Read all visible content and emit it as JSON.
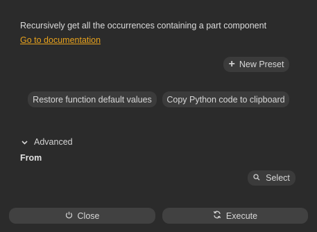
{
  "description": "Recursively get all the occurrences containing a part component",
  "doc_link": "Go to documentation",
  "presets": {
    "new_preset_label": "New Preset"
  },
  "actions": {
    "restore_label": "Restore function default values",
    "copy_label": "Copy Python code to clipboard"
  },
  "advanced": {
    "label": "Advanced"
  },
  "from": {
    "label": "From",
    "select_label": "Select"
  },
  "footer": {
    "close_label": "Close",
    "execute_label": "Execute"
  },
  "icons": {
    "new_preset": "plus-icon",
    "advanced": "chevron-down-icon",
    "select": "search-icon",
    "close": "power-icon",
    "execute": "refresh-icon"
  },
  "colors": {
    "accent_link": "#e8a21d",
    "background": "#2b2b2b",
    "button": "#3b3b3b"
  }
}
